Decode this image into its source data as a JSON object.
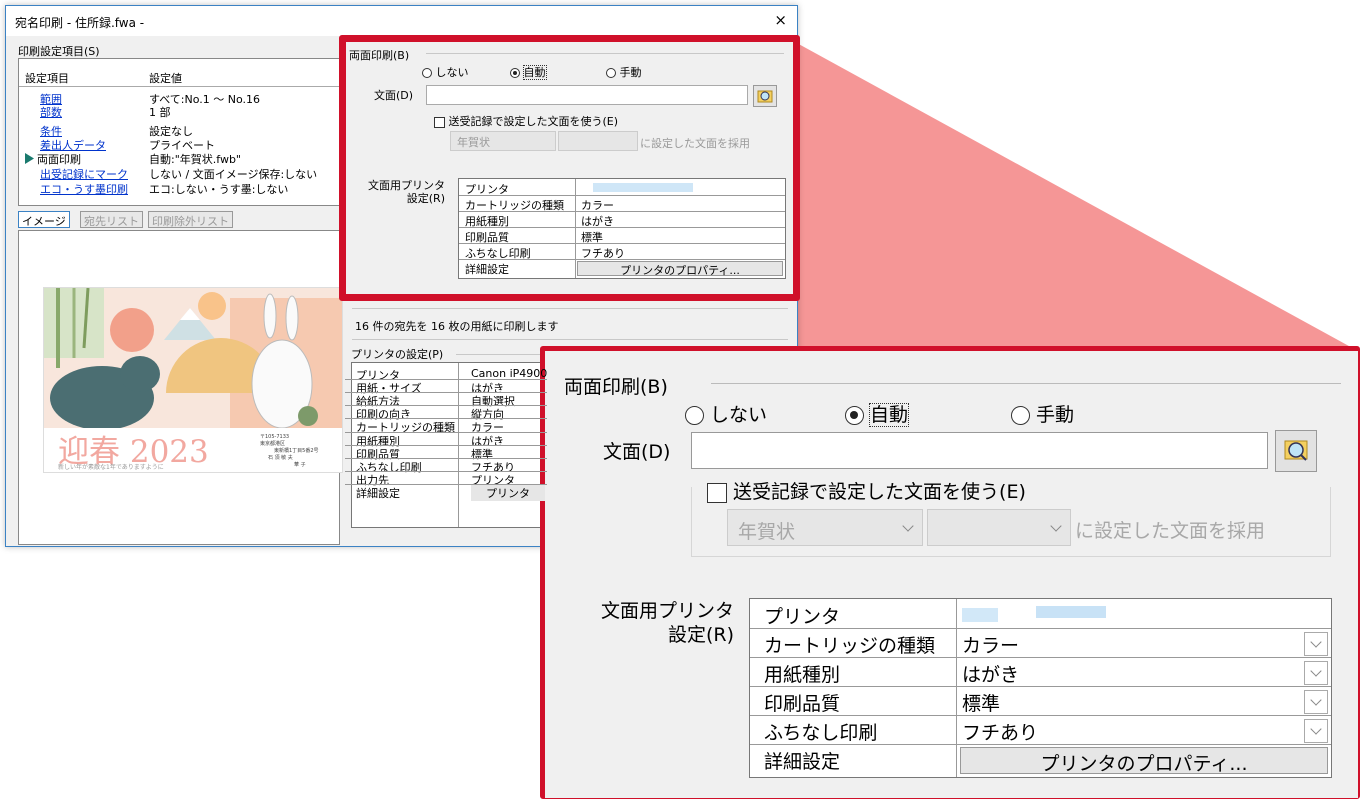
{
  "window": {
    "title": "宛名印刷 - 住所録.fwa -",
    "close": "×"
  },
  "settings_section": {
    "label": "印刷設定項目(S)"
  },
  "settings_table": {
    "header": [
      "設定項目",
      "設定値"
    ],
    "rows": [
      {
        "item": "範囲",
        "value": "すべて:No.1 〜 No.16"
      },
      {
        "item": "部数",
        "value": "1 部"
      },
      {
        "item": "条件",
        "value": "設定なし"
      },
      {
        "item": "差出人データ",
        "value": "プライベート"
      },
      {
        "item": "両面印刷",
        "value": "自動:\"年賀状.fwb\""
      },
      {
        "item": "出受記録にマーク",
        "value": "しない / 文面イメージ保存:しない"
      },
      {
        "item": "エコ・うす墨印刷",
        "value": "エコ:しない・うす墨:しない"
      }
    ]
  },
  "tabs": [
    "イメージ",
    "宛先リスト",
    "印刷除外リスト"
  ],
  "card": {
    "greeting": "迎春 2023",
    "wish": "新しい年が素敵な1年でありますように",
    "address": [
      "〒105-7133",
      "東京都港区",
      "東新橋1丁目5番2号"
    ],
    "names": [
      "石 須 敏 夫",
      "華 子"
    ]
  },
  "duplex": {
    "group_label": "両面印刷(B)",
    "options": [
      "しない",
      "自動",
      "手動"
    ],
    "selected": "自動",
    "design_label": "文面(D)",
    "design_value": "",
    "use_record_label": "送受記録で設定した文面を使う(E)",
    "use_record_checked": false,
    "record_select_value": "年賀状",
    "record_select_value2": "",
    "record_suffix": "に設定した文面を採用",
    "printer_settings_label": [
      "文面用プリンタ",
      "設定(R)"
    ],
    "rows": [
      {
        "label": "プリンタ",
        "value": ""
      },
      {
        "label": "カートリッジの種類",
        "value": "カラー"
      },
      {
        "label": "用紙種別",
        "value": "はがき"
      },
      {
        "label": "印刷品質",
        "value": "標準"
      },
      {
        "label": "ふちなし印刷",
        "value": "フチあり"
      },
      {
        "label": "詳細設定",
        "value": "プリンタのプロパティ..."
      }
    ]
  },
  "summary": "16 件の宛先を 16 枚の用紙に印刷します",
  "printer_section": {
    "label": "プリンタの設定(P)",
    "rows": [
      {
        "label": "プリンタ",
        "value": "Canon iP4900"
      },
      {
        "label": "用紙・サイズ",
        "value": "はがき"
      },
      {
        "label": "給紙方法",
        "value": "自動選択"
      },
      {
        "label": "印刷の向き",
        "value": "縦方向"
      },
      {
        "label": "カートリッジの種類",
        "value": "カラー"
      },
      {
        "label": "用紙種別",
        "value": "はがき"
      },
      {
        "label": "印刷品質",
        "value": "標準"
      },
      {
        "label": "ふちなし印刷",
        "value": "フチあり"
      },
      {
        "label": "出力先",
        "value": "プリンタ"
      },
      {
        "label": "詳細設定",
        "value": "プリンタ"
      }
    ]
  },
  "colors": {
    "highlight_red": "#d0102a",
    "zoom_fill": "#f48b8b",
    "link_blue": "#0033cc",
    "dialog_bg": "#f0f0f0"
  }
}
